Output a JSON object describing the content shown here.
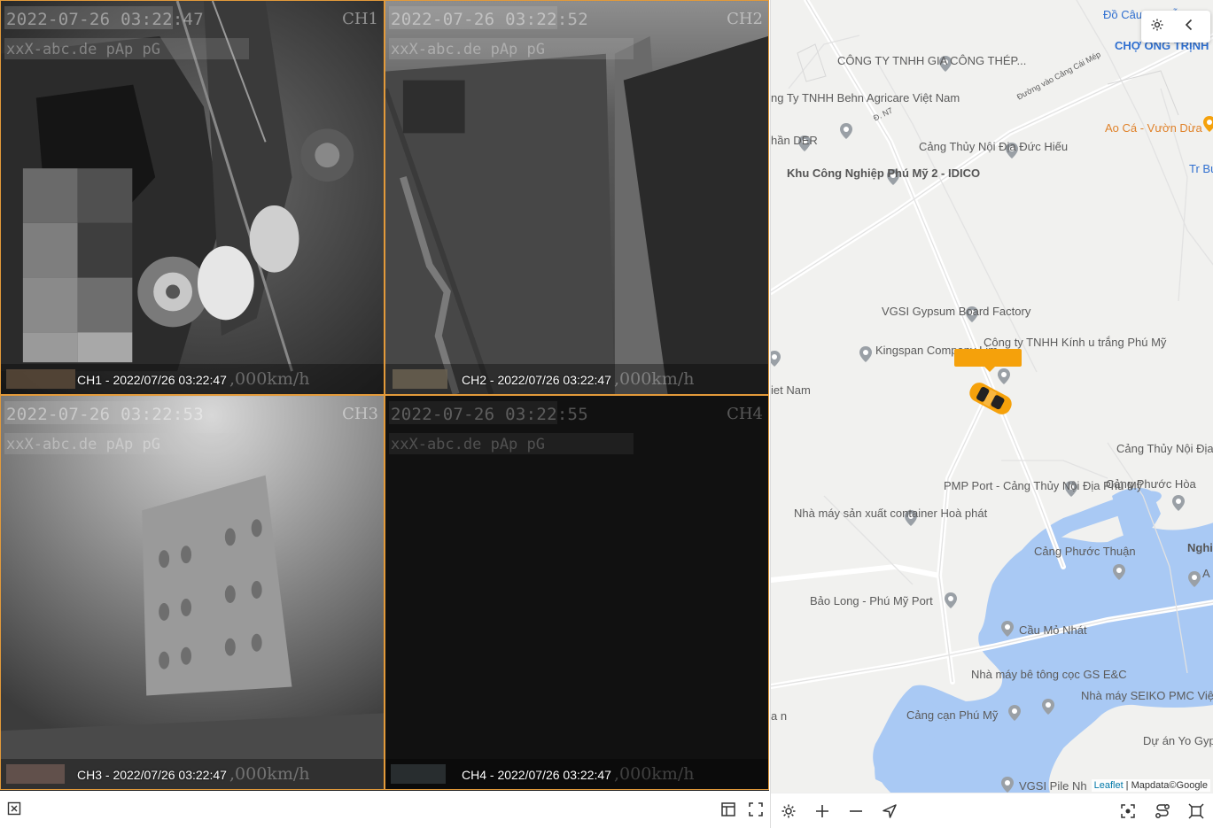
{
  "cameras": [
    {
      "id": "CH1",
      "osd_time": "2022-07-26 03:22:47",
      "osd_name": "xxX-abc.de  pAp pG",
      "caption": "CH1 - 2022/07/26 03:22:47",
      "osd_speed": ",000km/h"
    },
    {
      "id": "CH2",
      "osd_time": "2022-07-26 03:22:52",
      "osd_name": "xxX-abc.de  pAp pG",
      "caption": "CH2 - 2022/07/26 03:22:47",
      "osd_speed": ",000km/h"
    },
    {
      "id": "CH3",
      "osd_time": "2022-07-26 03:22:53",
      "osd_name": "xxX-abc.de  pAp pG",
      "caption": "CH3 - 2022/07/26 03:22:47",
      "osd_speed": ",000km/h"
    },
    {
      "id": "CH4",
      "osd_time": "2022-07-26 03:22:55",
      "osd_name": "xxX-abc.de  pAp pG",
      "caption": "CH4 - 2022/07/26 03:22:47",
      "osd_speed": ",000km/h"
    }
  ],
  "video_toolbar": {
    "close_icon": "close-box-icon",
    "layout_icon": "layout-icon",
    "fullscreen_icon": "fullscreen-icon"
  },
  "map": {
    "pois": [
      {
        "name": "Đồ Câu Nguyễn",
        "style": "blue"
      },
      {
        "name": "CHỢ ONG TRỊNH",
        "style": "blue"
      },
      {
        "name": "CÔNG TY TNHH GIA CÔNG THÉP...",
        "style": "normal"
      },
      {
        "name": "Đường vào Cảng Cái Mép",
        "style": "road"
      },
      {
        "name": "ng Ty TNHH Behn Agricare Việt Nam",
        "style": "normal"
      },
      {
        "name": "Đ. N7",
        "style": "road"
      },
      {
        "name": "Ao Cá - Vườn Dừa",
        "style": "orange"
      },
      {
        "name": "Cảng Thủy Nội Địa Đức Hiếu",
        "style": "normal"
      },
      {
        "name": "hần DER",
        "style": "normal"
      },
      {
        "name": "Khu Công Nghiệp Phú Mỹ 2 - IDICO",
        "style": "bold"
      },
      {
        "name": "Tr Bus",
        "style": "blue"
      },
      {
        "name": "VGSI Gypsum Board Factory",
        "style": "normal"
      },
      {
        "name": "Kingspan Company Lim",
        "style": "normal"
      },
      {
        "name": "Công ty TNHH Kính u trắng Phú Mỹ",
        "style": "normal"
      },
      {
        "name": "iet Nam",
        "style": "normal"
      },
      {
        "name": "Cảng Thủy Nội Địa Đức Hạnh",
        "style": "normal"
      },
      {
        "name": "Cảng Phước Hòa",
        "style": "normal"
      },
      {
        "name": "PMP Port - Cảng Thủy Nội Địa Phú Mỹ",
        "style": "normal"
      },
      {
        "name": "Nhà máy sản xuất container Hoà phát",
        "style": "normal"
      },
      {
        "name": "Cảng Phước Thuận",
        "style": "normal"
      },
      {
        "name": "Nghi",
        "style": "bold"
      },
      {
        "name": "A N",
        "style": "normal"
      },
      {
        "name": "Bảo Long - Phú Mỹ Port",
        "style": "normal"
      },
      {
        "name": "Cầu Mỏ Nhát",
        "style": "normal"
      },
      {
        "name": "Nhà máy bê tông cọc GS E&C",
        "style": "normal"
      },
      {
        "name": "Nhà máy SEIKO PMC Việt Nam",
        "style": "normal"
      },
      {
        "name": "Cảng cạn Phú Mỹ",
        "style": "normal"
      },
      {
        "name": "Dự án Yo Gypsum Việ",
        "style": "normal"
      },
      {
        "name": "VGSI Pile Nh",
        "style": "normal"
      },
      {
        "name": "a n",
        "style": "normal"
      }
    ],
    "attribution_leaflet": "Leaflet",
    "attribution_sep": " | ",
    "attribution_data": "Mapdata©Google",
    "colors": {
      "water": "#a9c9f4",
      "vehicle": "#f5a10b",
      "pin": "#9aa0a6"
    }
  },
  "map_controls": {
    "settings_icon": "gear-icon",
    "collapse_icon": "chevron-left-icon"
  },
  "map_toolbar": {
    "settings_icon": "gear-icon",
    "zoom_in_icon": "plus-icon",
    "zoom_out_icon": "minus-icon",
    "locate_icon": "navigation-arrow-icon",
    "fit_icon": "fit-bounds-icon",
    "route_icon": "route-icon",
    "expand_icon": "expand-icon"
  }
}
